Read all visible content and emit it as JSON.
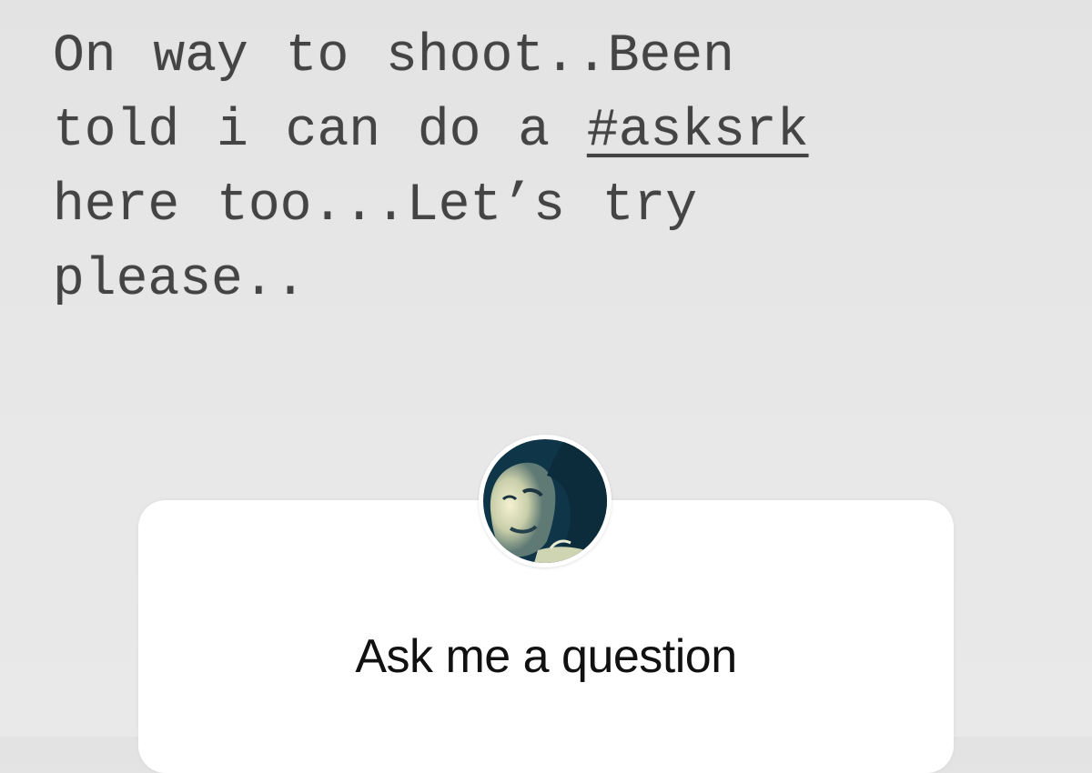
{
  "story": {
    "caption_lines": [
      "On way to shoot..Been",
      "told i can do a ",
      "here too...Let’s try",
      "please.."
    ],
    "hashtag": "#asksrk"
  },
  "question_sticker": {
    "prompt": "Ask me a question",
    "avatar_icon": "profile-photo",
    "card_color": "#ffffff",
    "avatar_tint": "#0f3548"
  }
}
